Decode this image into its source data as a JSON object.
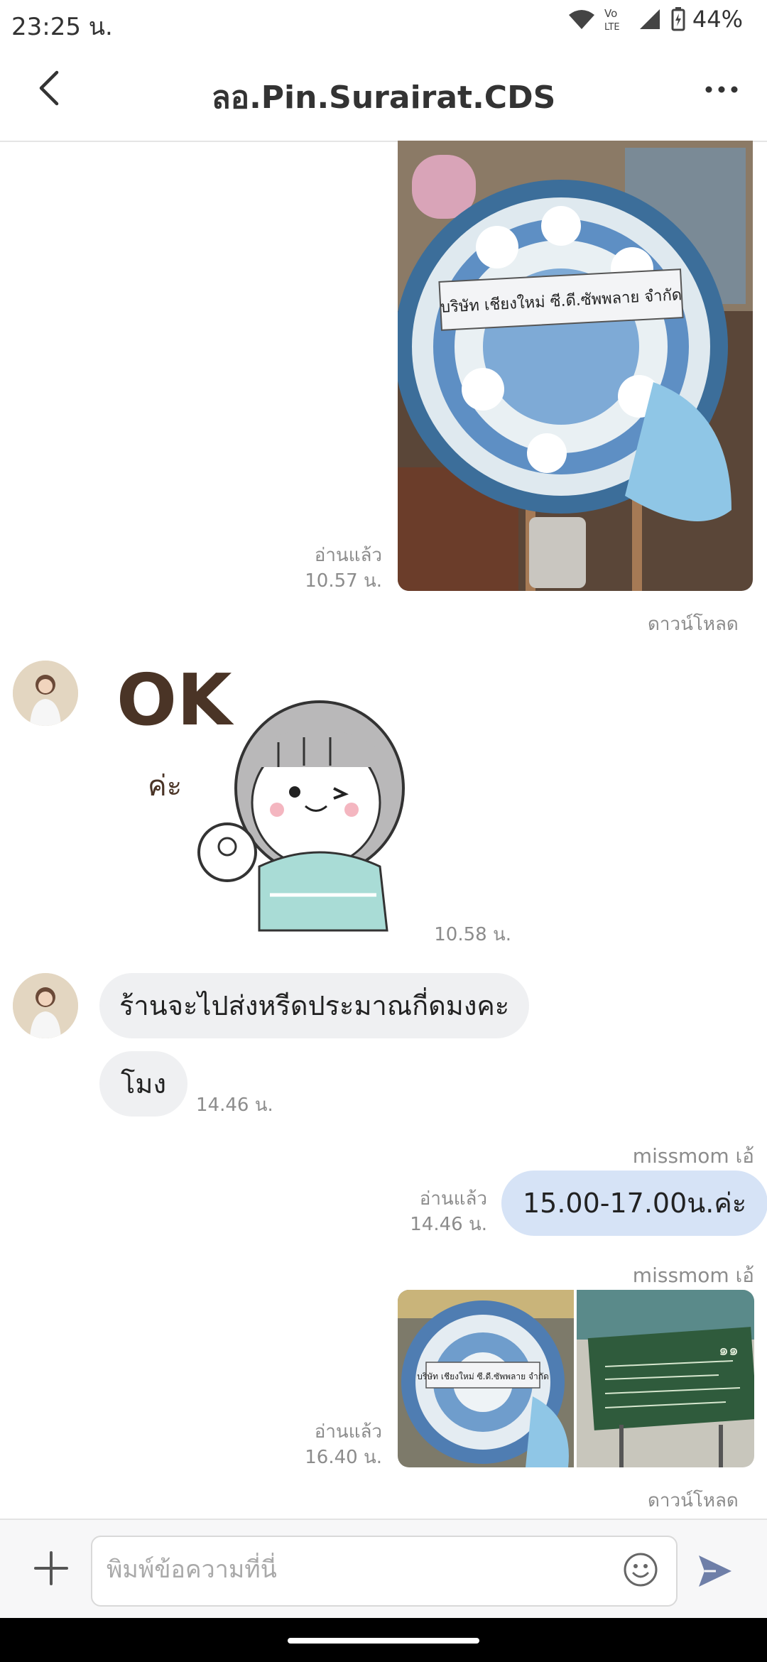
{
  "status_bar": {
    "time": "23:25 น.",
    "battery": "44%",
    "icons": [
      "wifi-icon",
      "volte-icon",
      "signal-icon",
      "battery-icon"
    ]
  },
  "header": {
    "title": "ลอ.Pin.Surairat.CDS",
    "back_icon": "chevron-left-icon",
    "more_icon": "more-horizontal-icon"
  },
  "messages": [
    {
      "type": "image",
      "from": "me",
      "read": "อ่านแล้ว",
      "time": "10.57 น.",
      "caption": "บริษัท เชียงใหม่ ซี.ดี.ซัพพลาย จำกัด",
      "download": "ดาวน์โหลด"
    },
    {
      "type": "sticker",
      "from": "them",
      "sticker_text": "OK",
      "sticker_sub": "ค่ะ",
      "time": "10.58 น."
    },
    {
      "type": "text",
      "from": "them",
      "text": "ร้านจะไปส่งหรีดประมาณกี่ดมงคะ"
    },
    {
      "type": "text",
      "from": "them",
      "text": "โมง",
      "time": "14.46 น."
    },
    {
      "type": "text",
      "from": "me",
      "sender": "missmom เอ้",
      "read": "อ่านแล้ว",
      "time": "14.46 น.",
      "text": "15.00-17.00น.ค่ะ"
    },
    {
      "type": "image_album",
      "from": "me",
      "sender": "missmom เอ้",
      "read": "อ่านแล้ว",
      "time": "16.40 น.",
      "caption": "บริษัท เชียงใหม่ ซี.ดี.ซัพพลาย จำกัด",
      "board_number": "๑๑",
      "download": "ดาวน์โหลด"
    }
  ],
  "input": {
    "placeholder": "พิมพ์ข้อความที่นี่",
    "plus_icon": "plus-icon",
    "emoji_icon": "emoji-icon",
    "send_icon": "send-icon"
  },
  "colors": {
    "outgoing_bubble": "#d6e3f6",
    "incoming_bubble": "#eff0f2",
    "send_accent": "#6f7fa8"
  }
}
